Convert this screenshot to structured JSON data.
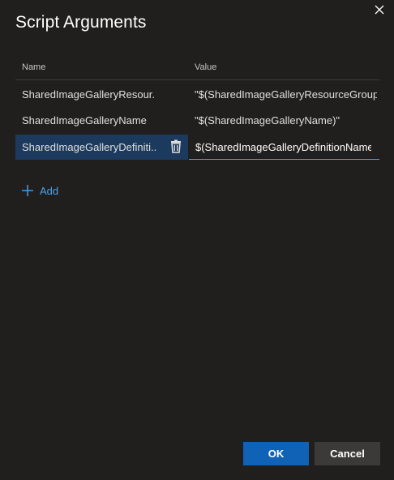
{
  "dialog": {
    "title": "Script Arguments",
    "close_icon": "close-icon"
  },
  "table": {
    "headers": {
      "name": "Name",
      "value": "Value"
    },
    "rows": [
      {
        "name": "SharedImageGalleryResour...",
        "value": "\"$(SharedImageGalleryResourceGroup)\""
      },
      {
        "name": "SharedImageGalleryName",
        "value": "\"$(SharedImageGalleryName)\""
      },
      {
        "name": "SharedImageGalleryDefiniti...",
        "value": "$(SharedImageGalleryDefinitionName)\""
      }
    ],
    "selected_row": 3,
    "delete_icon": "trash-icon"
  },
  "actions": {
    "add_label": "Add",
    "add_icon": "plus-icon",
    "ok_label": "OK",
    "cancel_label": "Cancel"
  },
  "colors": {
    "background": "#201f1e",
    "accent": "#4aa3f0",
    "primary_button": "#0f62b5",
    "secondary_button": "#3b3a39",
    "selected_row": "#1c3a5e"
  }
}
